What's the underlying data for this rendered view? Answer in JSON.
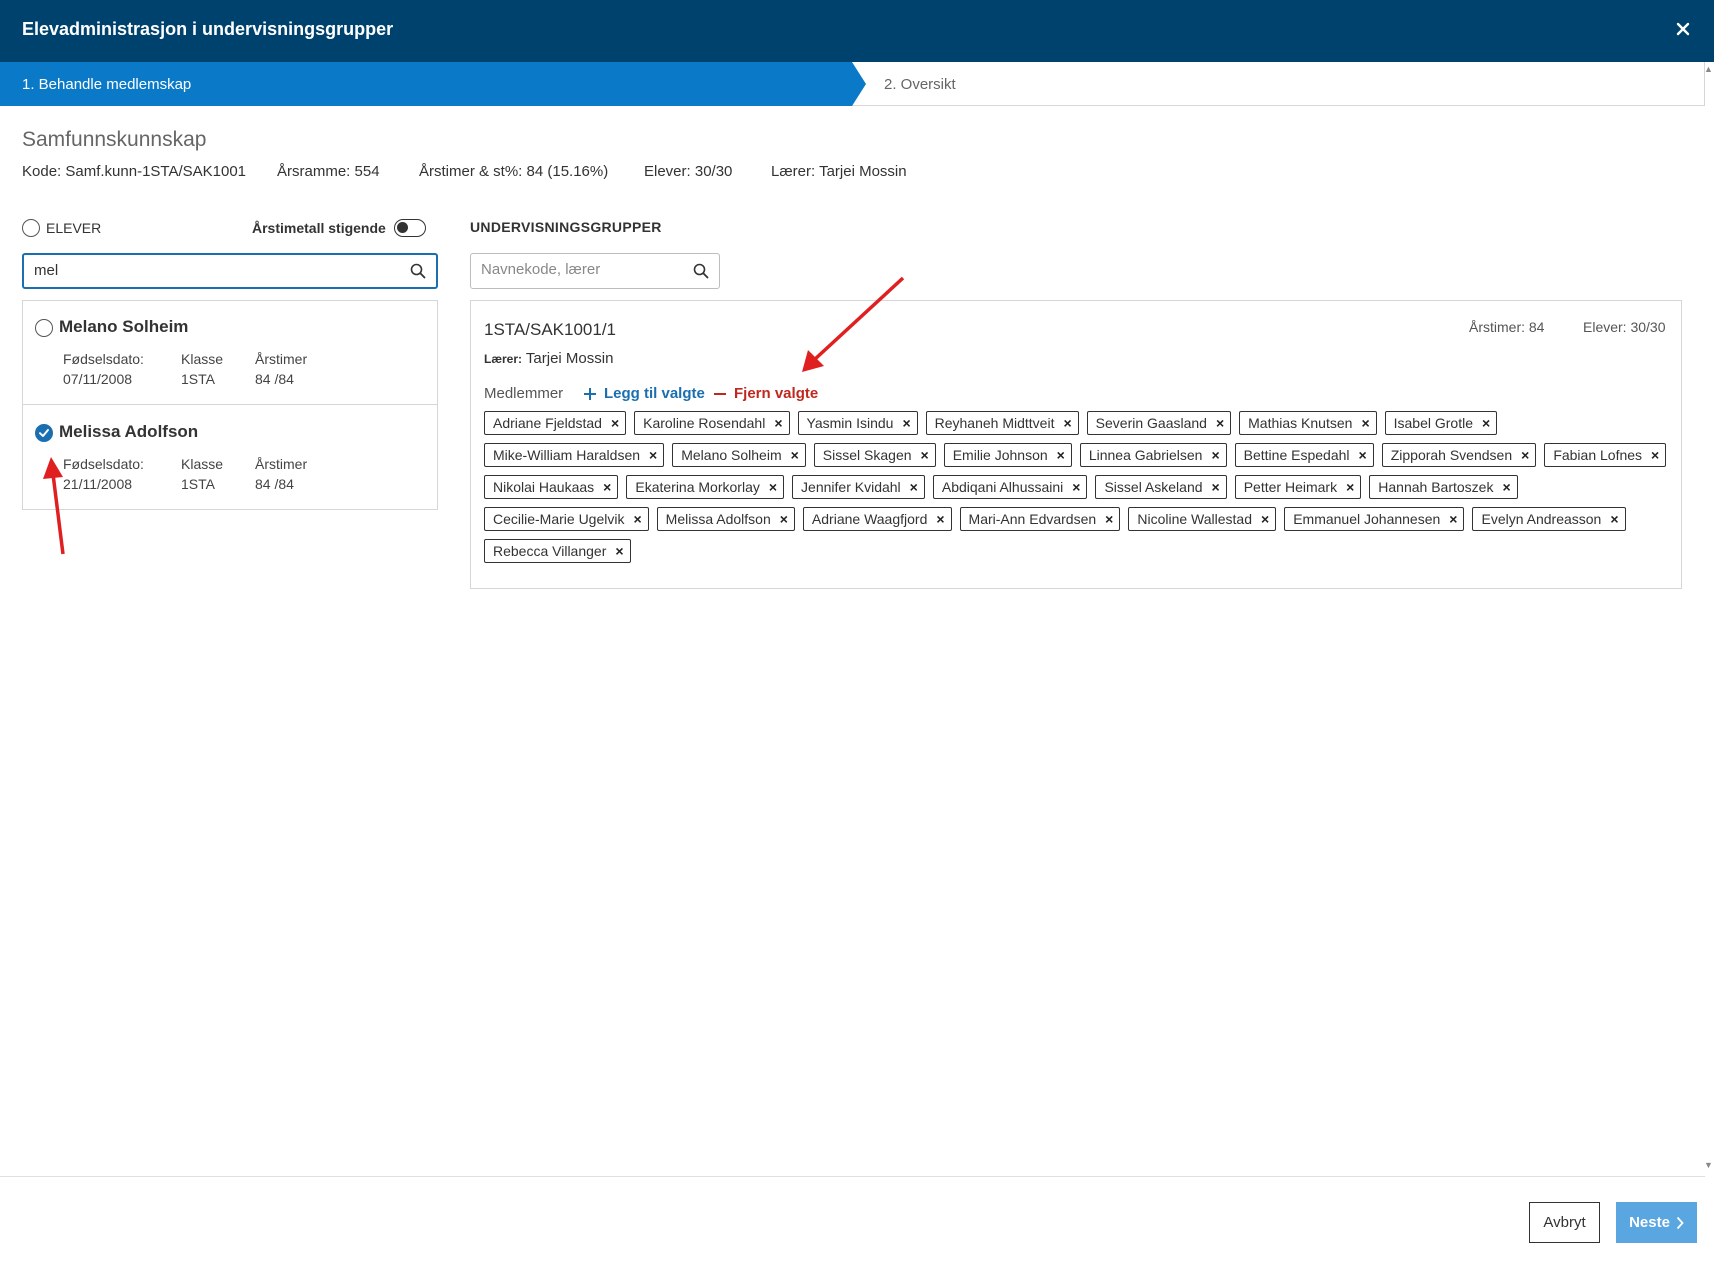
{
  "window": {
    "title": "Elevadministrasjon i undervisningsgrupper",
    "close_icon": "close-icon"
  },
  "stepper": {
    "steps": [
      {
        "label": "1. Behandle medlemskap",
        "active": true
      },
      {
        "label": "2. Oversikt",
        "active": false
      }
    ]
  },
  "subject": {
    "name": "Samfunnskunnskap",
    "meta": [
      "Kode: Samf.kunn-1STA/SAK1001",
      "Årsramme: 554",
      "Årstimer & st%: 84 (15.16%)",
      "Elever: 30/30",
      "Lærer: Tarjei Mossin"
    ]
  },
  "students_panel": {
    "select_all_label": "ELEVER",
    "sort_label": "Årstimetall stigende",
    "sort_toggle_on": false,
    "search_value": "mel",
    "field_labels": {
      "birth": "Fødselsdato:",
      "class": "Klasse",
      "hours": "Årstimer"
    },
    "students": [
      {
        "name": "Melano Solheim",
        "birth": "07/11/2008",
        "class": "1STA",
        "hours": "84 /84",
        "checked": false
      },
      {
        "name": "Melissa Adolfson",
        "birth": "21/11/2008",
        "class": "1STA",
        "hours": "84 /84",
        "checked": true
      }
    ]
  },
  "groups_panel": {
    "title": "UNDERVISNINGSGRUPPER",
    "search_placeholder": "Navnekode, lærer",
    "group": {
      "code": "1STA/SAK1001/1",
      "hours": "Årstimer: 84",
      "students": "Elever: 30/30",
      "teacher_label": "Lærer:",
      "teacher_name": "Tarjei Mossin",
      "members_label": "Medlemmer",
      "add_label": "Legg til valgte",
      "remove_label": "Fjern valgte",
      "members": [
        "Adriane Fjeldstad",
        "Karoline Rosendahl",
        "Yasmin Isindu",
        "Reyhaneh Midttveit",
        "Severin Gaasland",
        "Mathias Knutsen",
        "Isabel Grotle",
        "Mike-William Haraldsen",
        "Melano Solheim",
        "Sissel Skagen",
        "Emilie Johnson",
        "Linnea Gabrielsen",
        "Bettine Espedahl",
        "Zipporah Svendsen",
        "Fabian Lofnes",
        "Nikolai Haukaas",
        "Ekaterina Morkorlay",
        "Jennifer Kvidahl",
        "Abdiqani Alhussaini",
        "Sissel Askeland",
        "Petter Heimark",
        "Hannah Bartoszek",
        "Cecilie-Marie Ugelvik",
        "Melissa Adolfson",
        "Adriane Waagfjord",
        "Mari-Ann Edvardsen",
        "Nicoline Wallestad",
        "Emmanuel Johannesen",
        "Evelyn Andreasson",
        "Rebecca Villanger"
      ]
    }
  },
  "footer": {
    "cancel_label": "Avbryt",
    "next_label": "Neste"
  },
  "colors": {
    "titlebar": "#00426e",
    "step_active": "#0a7ac8",
    "accent": "#1a6fb0",
    "danger": "#c0281f",
    "next_button": "#5aa6e0",
    "annotation_arrow": "#e02020"
  }
}
